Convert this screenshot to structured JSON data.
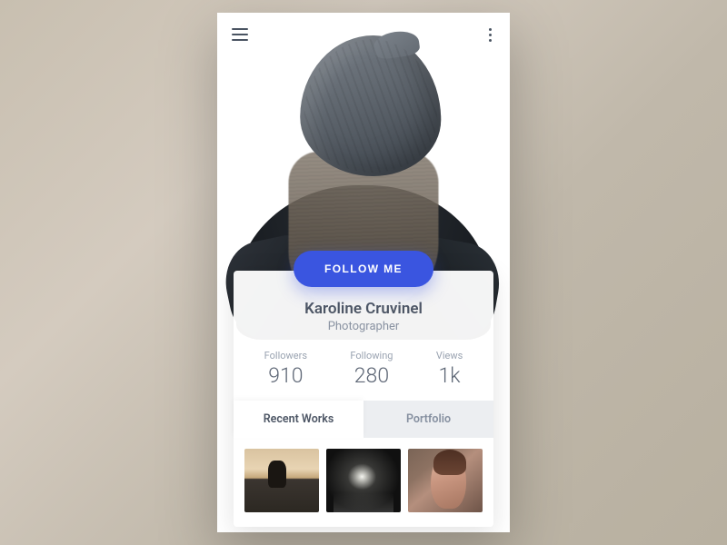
{
  "header": {
    "menu_icon": "hamburger-menu",
    "more_icon": "vertical-dots"
  },
  "follow_button": "FOLLOW ME",
  "profile": {
    "name": "Karoline Cruvinel",
    "role": "Photographer"
  },
  "stats": [
    {
      "label": "Followers",
      "value": "910"
    },
    {
      "label": "Following",
      "value": "280"
    },
    {
      "label": "Views",
      "value": "1k"
    }
  ],
  "tabs": [
    {
      "label": "Recent Works",
      "active": true
    },
    {
      "label": "Portfolio",
      "active": false
    }
  ],
  "thumbnails": [
    {
      "name": "sunset-silhouette"
    },
    {
      "name": "night-street"
    },
    {
      "name": "portrait-woman"
    }
  ],
  "colors": {
    "accent": "#3a55e0",
    "text_primary": "#4d5665",
    "text_secondary": "#8a93a2"
  }
}
